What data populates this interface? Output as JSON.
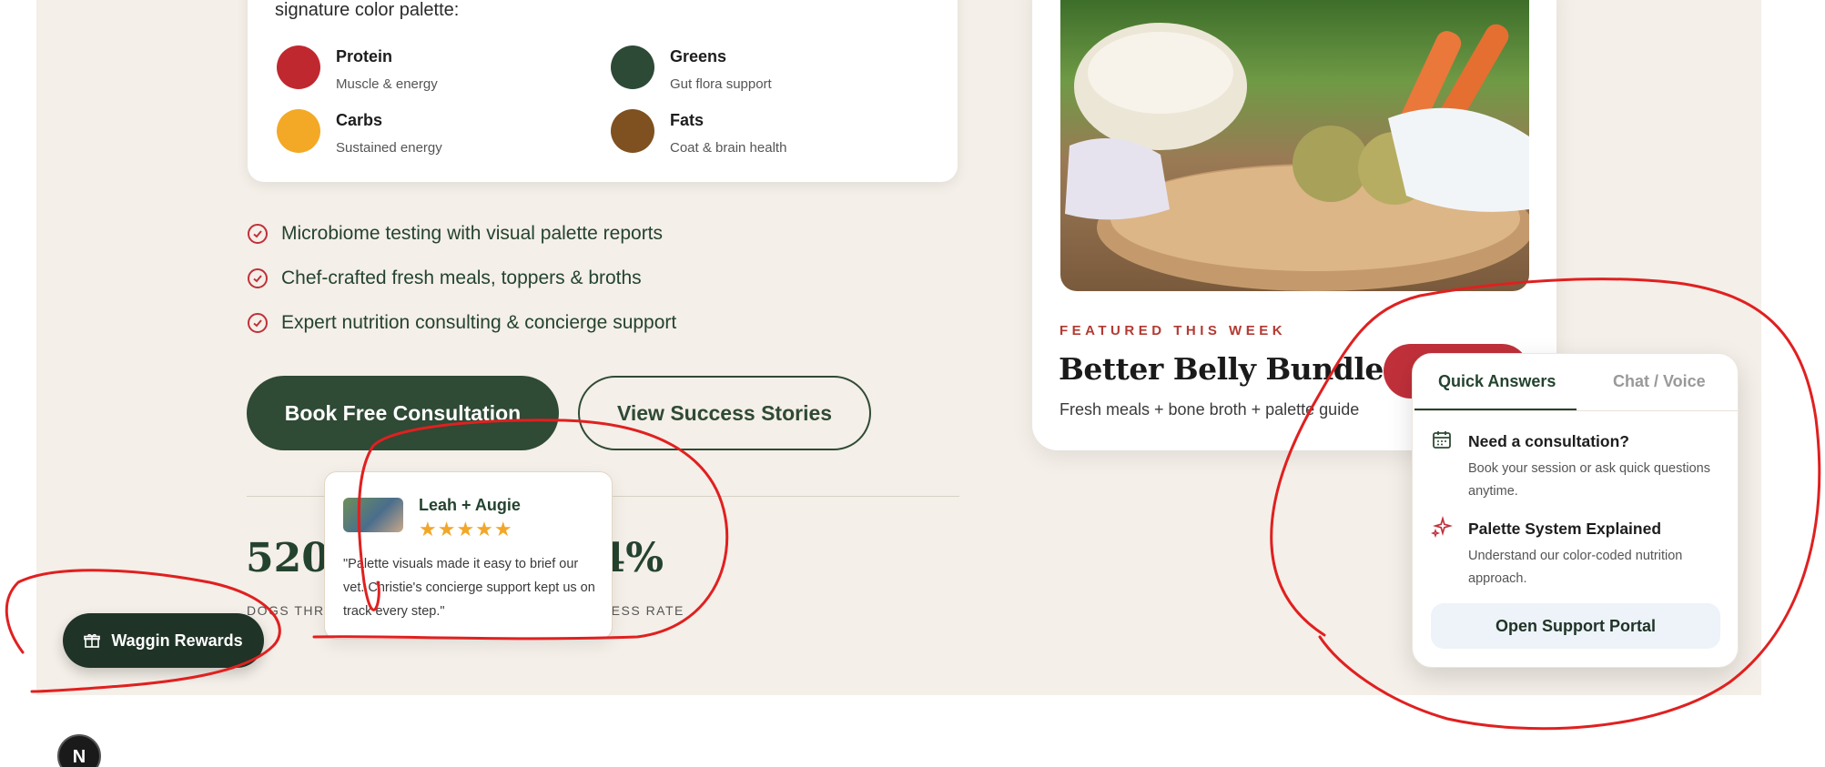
{
  "palette": {
    "intro": "signature color palette:",
    "items": [
      {
        "title": "Protein",
        "sub": "Muscle & energy",
        "color": "#c0282f"
      },
      {
        "title": "Greens",
        "sub": "Gut flora support",
        "color": "#2d4a36"
      },
      {
        "title": "Carbs",
        "sub": "Sustained energy",
        "color": "#f3a926"
      },
      {
        "title": "Fats",
        "sub": "Coat & brain health",
        "color": "#7f5120"
      }
    ]
  },
  "features": [
    "Microbiome testing with visual palette reports",
    "Chef-crafted fresh meals, toppers & broths",
    "Expert nutrition consulting & concierge support"
  ],
  "buttons": {
    "primary": "Book Free Consultation",
    "secondary": "View Success Stories"
  },
  "stats": [
    {
      "value": "520+",
      "label": "DOGS THRIVING"
    },
    {
      "value": "94%",
      "label": "SUCCESS RATE"
    }
  ],
  "testimonial": {
    "name": "Leah + Augie",
    "stars": "★★★★★",
    "quote": "\"Palette visuals made it easy to brief our vet. Christie's concierge support kept us on track every step.\""
  },
  "rewards": {
    "label": "Waggin Rewards"
  },
  "featured": {
    "kicker": "FEATURED THIS WEEK",
    "title": "Better Belly Bundle",
    "subtitle": "Fresh meals + bone broth + palette guide"
  },
  "support": {
    "tabs": [
      "Quick Answers",
      "Chat / Voice"
    ],
    "items": [
      {
        "title": "Need a consultation?",
        "text": "Book your session or ask quick questions anytime.",
        "icon": "calendar-icon"
      },
      {
        "title": "Palette System Explained",
        "text": "Understand our color-coded nutrition approach.",
        "icon": "sparkle-icon"
      }
    ],
    "portal": "Open Support Portal"
  },
  "badge": {
    "label": "N"
  },
  "colors": {
    "accent": "#c0303a",
    "brand_green": "#2f4a35",
    "background": "#f4efe8",
    "annotation": "#e02020"
  }
}
